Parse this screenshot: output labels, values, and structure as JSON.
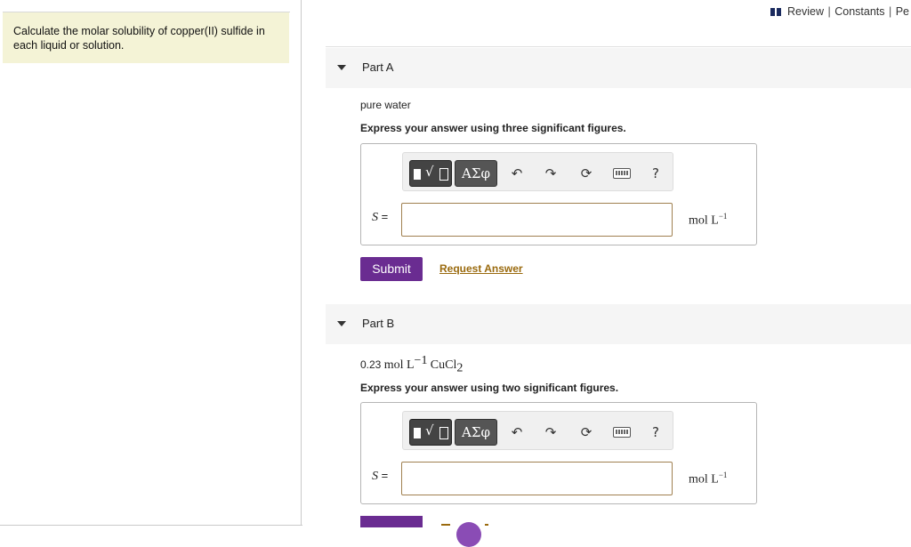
{
  "intro": {
    "text": "Calculate the molar solubility of copper(II) sulfide in each liquid or solution."
  },
  "top_links": {
    "book_icon": "book-icon",
    "review": "Review",
    "sep": "|",
    "constants": "Constants",
    "periodic": "Pe"
  },
  "toolbar": {
    "math_icon": "templates-sqrt-icon",
    "greek": "ΑΣφ",
    "undo": "↶",
    "redo": "↷",
    "reset": "⟳",
    "keyboard_icon": "keyboard-icon",
    "help": "?"
  },
  "parts": [
    {
      "title": "Part A",
      "prompt": "pure water",
      "instruction": "Express your answer using three significant figures.",
      "var": "S",
      "eq": " =",
      "value": "",
      "unit_base": "mol L",
      "unit_exp": "−1",
      "submit": "Submit",
      "request": "Request Answer"
    },
    {
      "title": "Part B",
      "prompt_num": "0.23",
      "prompt_unit": "mol L",
      "prompt_exp": "−1",
      "prompt_chem": "CuCl",
      "prompt_sub": "2",
      "instruction": "Express your answer using two significant figures.",
      "var": "S",
      "eq": " =",
      "value": "",
      "unit_base": "mol L",
      "unit_exp": "−1"
    }
  ],
  "colors": {
    "intro_bg": "#f4f3d6",
    "submit_bg": "#6a2c91",
    "link": "#9a6a0e",
    "book": "#1a2a5e"
  }
}
